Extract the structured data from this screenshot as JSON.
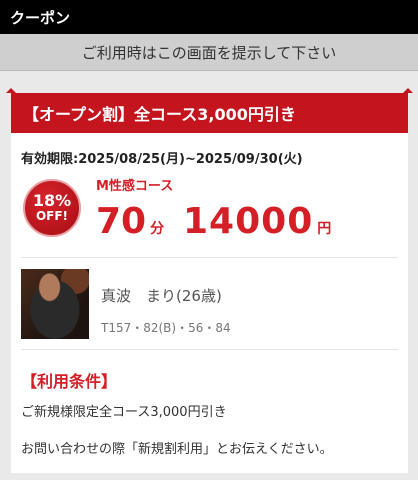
{
  "header": {
    "title": "クーポン"
  },
  "notice": "ご利用時はこの画面を提示して下さい",
  "coupon": {
    "ribbon_title": "【オープン割】全コース3,000円引き",
    "valid_period": "有効期限:2025/08/25(月)~2025/09/30(火)",
    "badge": {
      "percent": "18%",
      "off": "OFF!"
    },
    "course_name": "M性感コース",
    "minutes": "70",
    "minutes_unit": "分",
    "price": "14000",
    "price_unit": "円"
  },
  "therapist": {
    "name": "真波　まり(26歳)",
    "stats": "T157・82(B)・56・84"
  },
  "conditions": {
    "title": "【利用条件】",
    "line1": "ご新規様限定全コース3,000円引き",
    "line2": "お問い合わせの際「新規割利用」とお伝えください。"
  },
  "colors": {
    "accent": "#c4141d",
    "header_bg": "#000000",
    "notice_bg": "#cfcfcf"
  }
}
